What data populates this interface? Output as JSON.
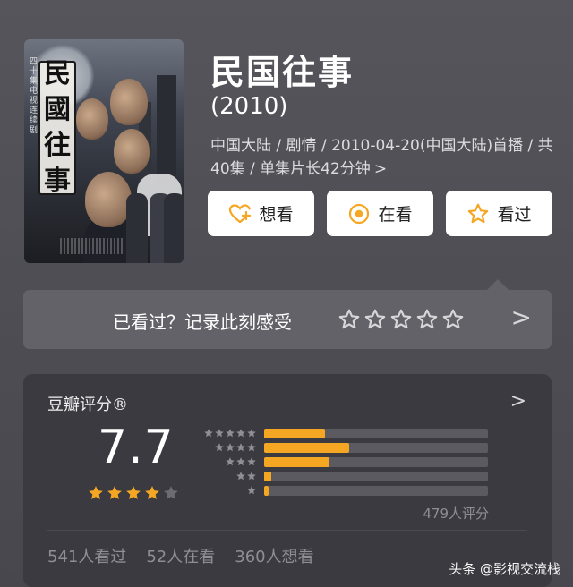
{
  "poster": {
    "title_chars": [
      "民",
      "國",
      "往",
      "事"
    ],
    "side_text": "四十集电视连续剧"
  },
  "movie": {
    "title": "民国往事",
    "year": "(2010)",
    "meta": "中国大陆 / 剧情 / 2010-04-20(中国大陆)首播 / 共40集 / 单集片长42分钟",
    "meta_chevron": ">"
  },
  "actions": {
    "want": {
      "label": "想看",
      "icon": "heart-plus-icon"
    },
    "watching": {
      "label": "在看",
      "icon": "target-circle-icon"
    },
    "watched": {
      "label": "看过",
      "icon": "star-outline-icon"
    },
    "accent": "#f5a623"
  },
  "review": {
    "label": "已看过？记录此刻感受",
    "star_count": 5,
    "chevron": ">"
  },
  "rating": {
    "label": "豆瓣评分®",
    "chevron": ">",
    "score": "7.7",
    "stars_filled": 4,
    "stars_total": 5,
    "distribution": [
      {
        "stars": 5,
        "fraction": 0.27
      },
      {
        "stars": 4,
        "fraction": 0.38
      },
      {
        "stars": 3,
        "fraction": 0.29
      },
      {
        "stars": 2,
        "fraction": 0.03
      },
      {
        "stars": 1,
        "fraction": 0.02
      }
    ],
    "count_text": "479人评分",
    "stats": {
      "watched": "541人看过",
      "watching": "52人在看",
      "want": "360人想看"
    }
  },
  "watermark": "头条 @影视交流栈",
  "colors": {
    "accent": "#f5a623",
    "card": "#3a3a40",
    "strip": "#626268"
  }
}
